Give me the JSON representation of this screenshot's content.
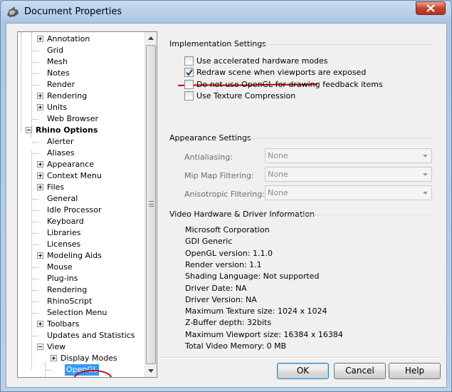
{
  "window": {
    "title": "Document Properties"
  },
  "tree": {
    "items": [
      {
        "label": "Annotation"
      },
      {
        "label": "Grid"
      },
      {
        "label": "Mesh"
      },
      {
        "label": "Notes"
      },
      {
        "label": "Render"
      },
      {
        "label": "Rendering"
      },
      {
        "label": "Units"
      },
      {
        "label": "Web Browser"
      },
      {
        "label": "Rhino Options"
      },
      {
        "label": "Alerter"
      },
      {
        "label": "Aliases"
      },
      {
        "label": "Appearance"
      },
      {
        "label": "Context Menu"
      },
      {
        "label": "Files"
      },
      {
        "label": "General"
      },
      {
        "label": "Idle Processor"
      },
      {
        "label": "Keyboard"
      },
      {
        "label": "Libraries"
      },
      {
        "label": "Licenses"
      },
      {
        "label": "Modeling Aids"
      },
      {
        "label": "Mouse"
      },
      {
        "label": "Plug-ins"
      },
      {
        "label": "Rendering"
      },
      {
        "label": "RhinoScript"
      },
      {
        "label": "Selection Menu"
      },
      {
        "label": "Toolbars"
      },
      {
        "label": "Updates and Statistics"
      },
      {
        "label": "View"
      },
      {
        "label": "Display Modes"
      },
      {
        "label": "OpenGL"
      }
    ],
    "selected": "OpenGL"
  },
  "implementation": {
    "title": "Implementation Settings",
    "options": [
      {
        "label": "Use accelerated hardware modes",
        "checked": false
      },
      {
        "label": "Redraw scene when viewports are exposed",
        "checked": true
      },
      {
        "label": "Do not use OpenGL for drawing feedback items",
        "checked": false
      },
      {
        "label": "Use Texture Compression",
        "checked": false
      }
    ]
  },
  "appearance": {
    "title": "Appearance Settings",
    "fields": [
      {
        "label": "Antialiasing:",
        "value": "None"
      },
      {
        "label": "Mip Map Filtering:",
        "value": "None"
      },
      {
        "label": "Anisotropic Filtering:",
        "value": "None"
      }
    ]
  },
  "video": {
    "title": "Video Hardware & Driver Information",
    "lines": [
      "Microsoft Corporation",
      "GDI Generic",
      "OpenGL version: 1.1.0",
      "Render version: 1.1",
      "Shading Language: Not supported",
      "Driver Date: NA",
      "Driver Version: NA",
      "Maximum Texture size: 1024 x 1024",
      "Z-Buffer depth: 32bits",
      "Maximum Viewport size: 16384 x 16384",
      "Total Video Memory: 0 MB"
    ]
  },
  "buttons": {
    "ok": "OK",
    "cancel": "Cancel",
    "help": "Help"
  },
  "colors": {
    "selection": "#3399ff",
    "annotation_red": "#cc0000"
  }
}
